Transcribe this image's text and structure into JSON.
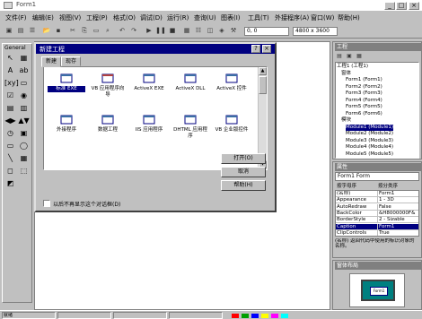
{
  "app": {
    "title": "Form1",
    "window_buttons": [
      "_",
      "□",
      "×"
    ]
  },
  "menu": {
    "items": [
      "文件(F)",
      "编辑(E)",
      "视图(V)",
      "工程(P)",
      "格式(O)",
      "调试(D)",
      "运行(R)",
      "查询(U)",
      "图表(I)",
      "工具(T)",
      "外接程序(A)",
      "窗口(W)",
      "帮助(H)"
    ]
  },
  "toolbar": {
    "position_readout": "0, 0",
    "size_readout": "4800 x 3600"
  },
  "toolbox": {
    "title": "General",
    "tools": [
      "↖",
      "▦",
      "A",
      "ab",
      "[xy]",
      "▭",
      "☑",
      "◉",
      "▤",
      "▥",
      "◀▶",
      "▲▼",
      "◷",
      "▣",
      "▭",
      "◯",
      "╲",
      "▦",
      "◻",
      "⬚",
      "◩"
    ]
  },
  "dialog": {
    "title": "新建工程",
    "help_btn": "?",
    "close_btn": "×",
    "tabs": [
      "新建",
      "现存"
    ],
    "items": [
      {
        "label": "标准 EXE",
        "selected": true
      },
      {
        "label": "VB 应用程序向导",
        "selected": false
      },
      {
        "label": "ActiveX EXE",
        "selected": false
      },
      {
        "label": "ActiveX DLL",
        "selected": false
      },
      {
        "label": "ActiveX 控件",
        "selected": false
      },
      {
        "label": "外接程序",
        "selected": false
      },
      {
        "label": "数据工程",
        "selected": false
      },
      {
        "label": "IIS 应用程序",
        "selected": false
      },
      {
        "label": "DHTML 应用程序",
        "selected": false
      },
      {
        "label": "VB 企业版控件",
        "selected": false
      }
    ],
    "buttons": [
      "打开(O)",
      "取消",
      "帮助(H)"
    ],
    "checkbox_label": "以后不再显示这个对话框(D)"
  },
  "project": {
    "title": "工程",
    "tree": [
      {
        "label": "工程1 (工程1)",
        "selected": false
      },
      {
        "label": "窗体",
        "selected": false
      },
      {
        "label": "Form1 (Form1)",
        "selected": false
      },
      {
        "label": "Form2 (Form2)",
        "selected": false
      },
      {
        "label": "Form3 (Form3)",
        "selected": false
      },
      {
        "label": "Form4 (Form4)",
        "selected": false
      },
      {
        "label": "Form5 (Form5)",
        "selected": false
      },
      {
        "label": "Form6 (Form6)",
        "selected": false
      },
      {
        "label": "模块",
        "selected": false
      },
      {
        "label": "Module1 (Module1)",
        "selected": true
      },
      {
        "label": "Module2 (Module2)",
        "selected": false
      },
      {
        "label": "Module3 (Module3)",
        "selected": false
      },
      {
        "label": "Module4 (Module4)",
        "selected": false
      },
      {
        "label": "Module5 (Module5)",
        "selected": false
      }
    ]
  },
  "properties": {
    "title": "属性",
    "object": "Form1 Form",
    "tabs": [
      "按字母序",
      "按分类序"
    ],
    "rows": [
      {
        "name": "(名称)",
        "value": "Form1",
        "selected": false
      },
      {
        "name": "Appearance",
        "value": "1 - 3D",
        "selected": false
      },
      {
        "name": "AutoRedraw",
        "value": "False",
        "selected": false
      },
      {
        "name": "BackColor",
        "value": "&H8000000F&",
        "selected": false
      },
      {
        "name": "BorderStyle",
        "value": "2 - Sizable",
        "selected": false
      },
      {
        "name": "Caption",
        "value": "Form1",
        "selected": true
      },
      {
        "name": "ClipControls",
        "value": "True",
        "selected": false
      }
    ],
    "description": "(名称) 返回代码中使用的标识对象的名称。"
  },
  "layout": {
    "title": "窗体布局",
    "form_label": "Form1"
  },
  "status": {
    "segments": [
      "就绪",
      "",
      "",
      ""
    ],
    "colors": [
      "#ff0000",
      "#00a000",
      "#0000ff",
      "#ffff00",
      "#ff00ff",
      "#00ffff"
    ]
  }
}
